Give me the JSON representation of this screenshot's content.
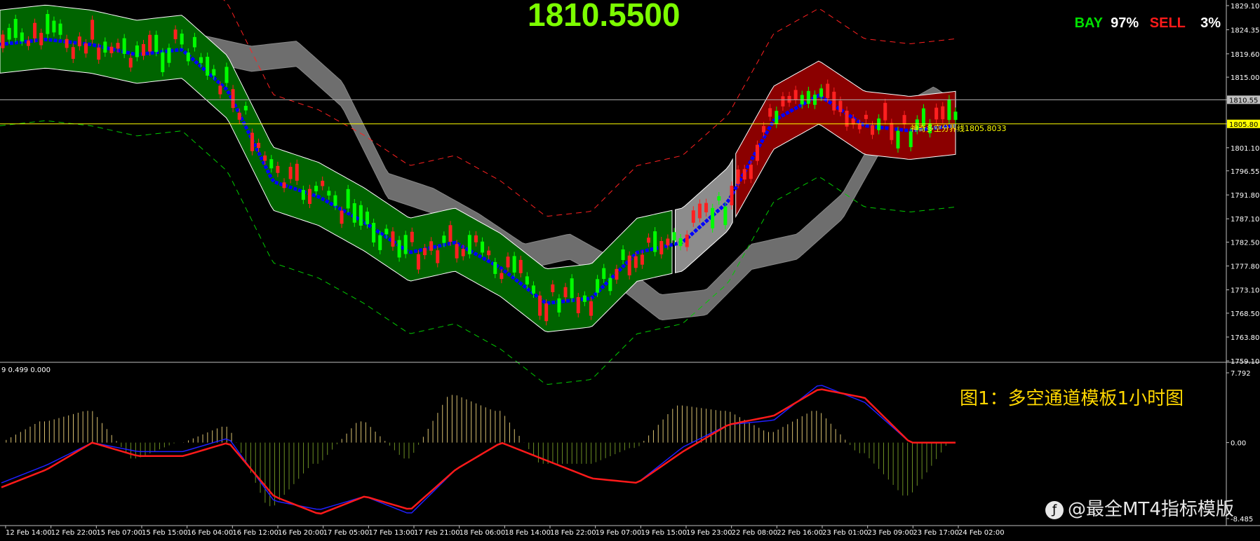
{
  "header": {
    "current_price": "1810.5500"
  },
  "stats": {
    "buy_label": "BAY",
    "buy_pct": "97%",
    "sell_label": "SELL",
    "sell_pct": "3%"
  },
  "colors": {
    "bull": "#00ff00",
    "bear": "#ff2020",
    "channel_fill": "#006400",
    "red_channel_fill": "#8b0000",
    "gray_band": "#6e6e6e",
    "ma_line": "#0000ff",
    "level_line": "#ffff00",
    "signal": "#ff00ff"
  },
  "annotations": {
    "caption": "图1：多空通道模板1小时图",
    "watermark": "@最全MT4指标模版",
    "level_label": "神奇多空分界线1805.8033",
    "indicator_header": "9 0.499 0.000"
  },
  "chart_data": [
    {
      "type": "line",
      "subtype": "candlestick-with-channels",
      "title": "",
      "y_ticks": [
        "1829.10",
        "1824.35",
        "1819.60",
        "1815.00",
        "1810.55",
        "1805.80",
        "1801.10",
        "1796.55",
        "1791.80",
        "1787.10",
        "1782.50",
        "1777.80",
        "1773.10",
        "1768.50",
        "1763.80",
        "1759.10"
      ],
      "ylim": [
        1759.1,
        1829.1
      ],
      "current_price_tag": "1810.55",
      "level_tag": "1805.80",
      "x_ticks": [
        "12 Feb 14:00",
        "12 Feb 22:00",
        "15 Feb 07:00",
        "15 Feb 15:00",
        "16 Feb 04:00",
        "16 Feb 12:00",
        "16 Feb 20:00",
        "17 Feb 05:00",
        "17 Feb 13:00",
        "17 Feb 21:00",
        "18 Feb 06:00",
        "18 Feb 14:00",
        "18 Feb 22:00",
        "19 Feb 07:00",
        "19 Feb 15:00",
        "19 Feb 23:00",
        "22 Feb 08:00",
        "22 Feb 16:00",
        "23 Feb 01:00",
        "23 Feb 09:00",
        "23 Feb 17:00",
        "24 Feb 02:00"
      ],
      "series": [
        {
          "x": [
            0,
            1,
            2,
            3,
            4,
            5,
            6,
            7,
            8,
            9,
            10,
            11,
            12,
            13,
            14,
            15,
            16,
            17,
            18,
            19,
            20,
            21
          ],
          "values": [
            1822,
            1823,
            1822,
            1820,
            1821,
            1813,
            1795,
            1792,
            1787,
            1781,
            1783,
            1778,
            1771,
            1772,
            1781,
            1783,
            1791,
            1807,
            1812,
            1806,
            1805,
            1806
          ]
        }
      ]
    },
    {
      "type": "line",
      "subtype": "oscillator",
      "title": "",
      "y_ticks": [
        "7.792",
        "0.00",
        "-8.485"
      ],
      "ylim": [
        -8.485,
        7.792
      ],
      "series": [
        {
          "values": [
            -5,
            -3,
            0,
            -1.5,
            -1.5,
            0,
            -6,
            -8,
            -6,
            -7.5,
            -3,
            0,
            -2,
            -4,
            -4.5,
            -1,
            2,
            3,
            6,
            5,
            0,
            0
          ]
        },
        {
          "values": [
            -4.5,
            -2.5,
            0,
            -1,
            -1,
            0.5,
            -6.5,
            -7.5,
            -6,
            -8,
            -3,
            0,
            -2,
            -4,
            -4.5,
            -0.5,
            2,
            2.5,
            6.5,
            4.5,
            0,
            0
          ]
        }
      ]
    }
  ]
}
